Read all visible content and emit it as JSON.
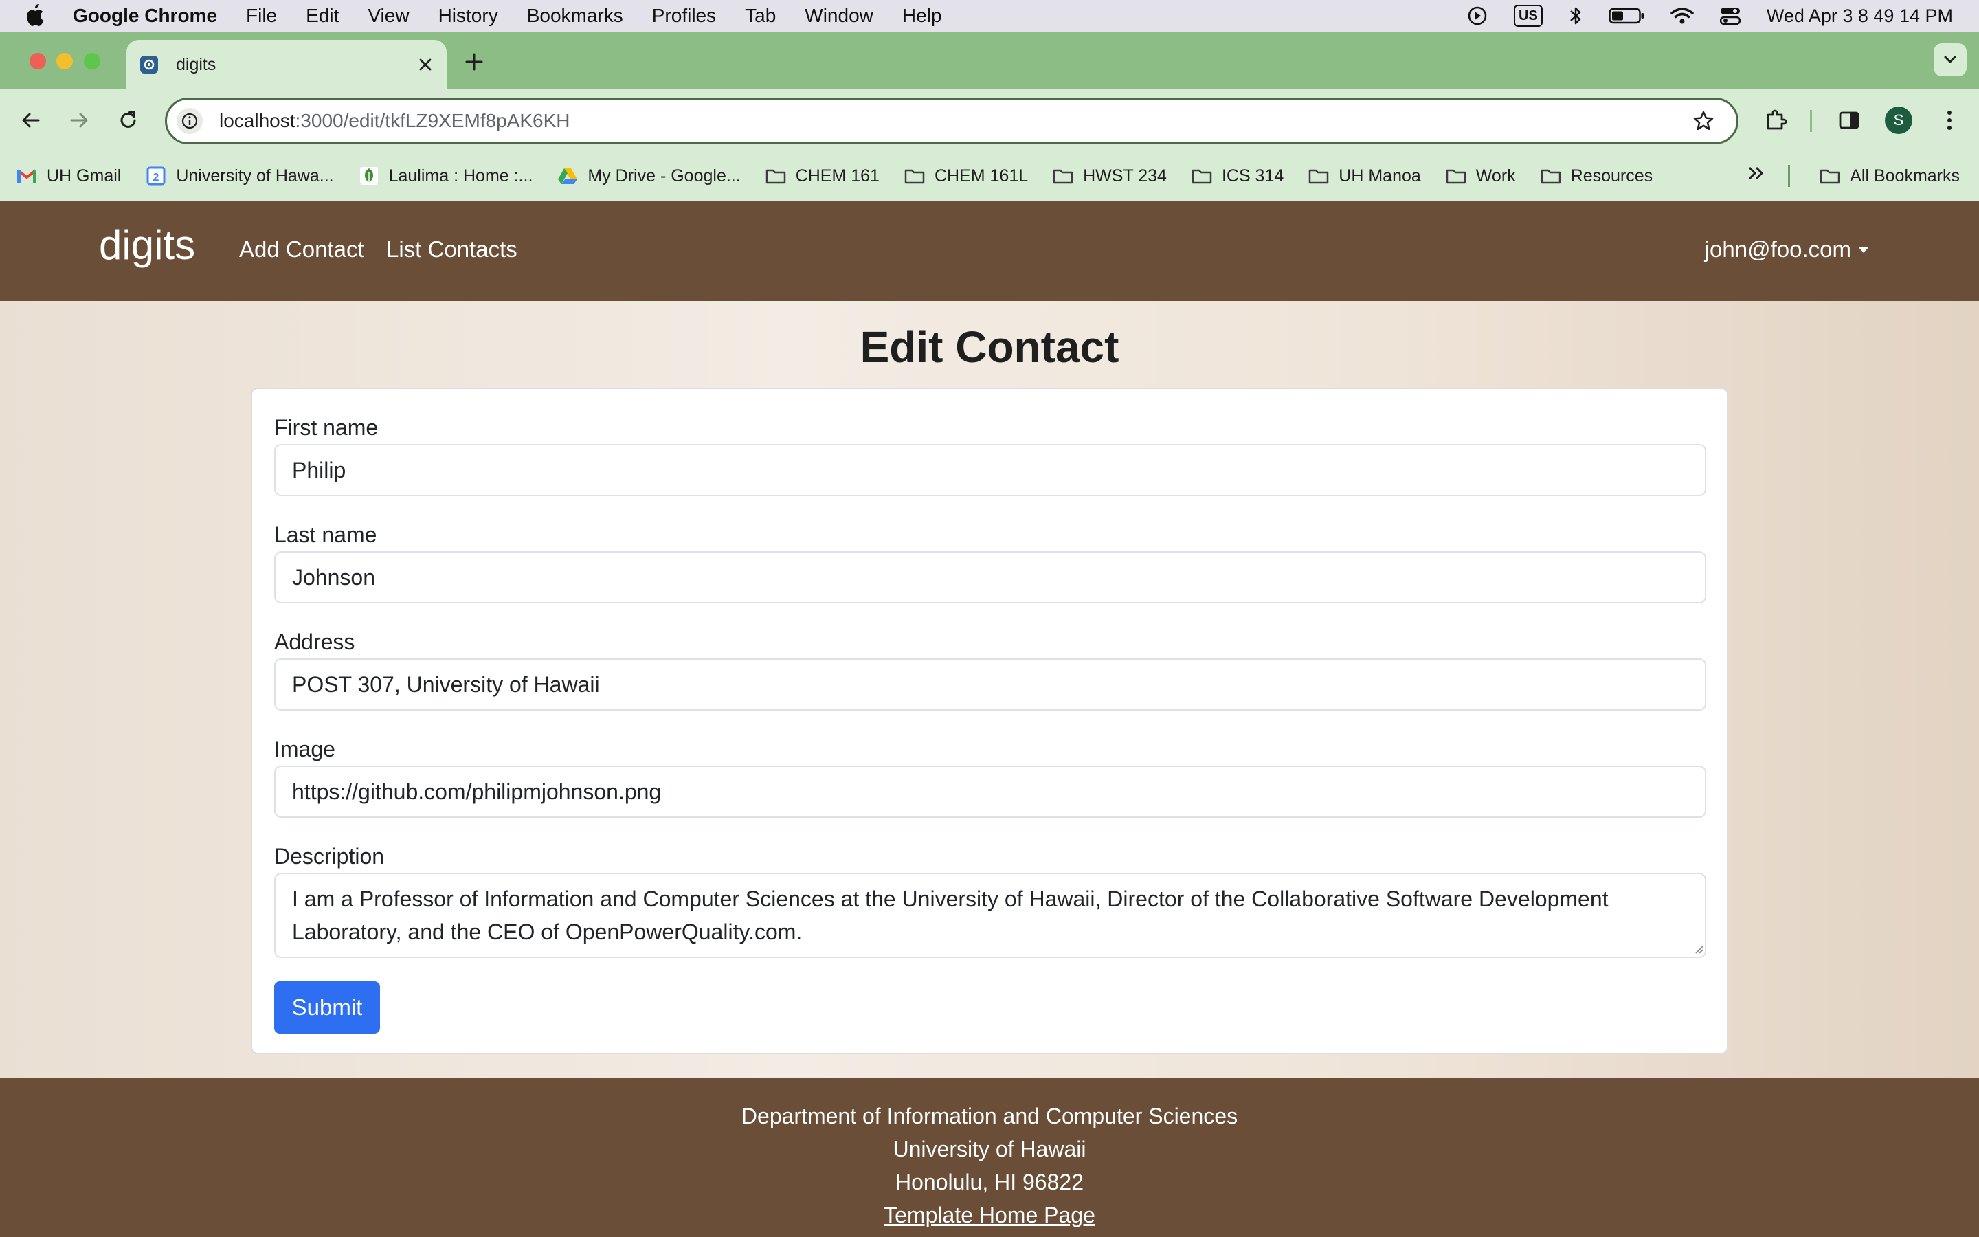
{
  "menubar": {
    "app_name": "Google Chrome",
    "items": [
      "File",
      "Edit",
      "View",
      "History",
      "Bookmarks",
      "Profiles",
      "Tab",
      "Window",
      "Help"
    ],
    "input_source": "US",
    "clock": "Wed Apr 3  8 49 14 PM"
  },
  "browser": {
    "tab_title": "digits",
    "url_host": "localhost",
    "url_path": ":3000/edit/tkfLZ9XEMf8pAK6KH",
    "profile_initial": "S",
    "bookmarks": [
      "UH Gmail",
      "University of Hawa...",
      "Laulima : Home :...",
      "My Drive - Google...",
      "CHEM 161",
      "CHEM 161L",
      "HWST 234",
      "ICS 314",
      "UH Manoa",
      "Work",
      "Resources"
    ],
    "all_bookmarks": "All Bookmarks"
  },
  "navbar": {
    "brand": "digits",
    "links": [
      "Add Contact",
      "List Contacts"
    ],
    "user": "john@foo.com"
  },
  "form": {
    "title": "Edit Contact",
    "fields": [
      {
        "label": "First name",
        "value": "Philip"
      },
      {
        "label": "Last name",
        "value": "Johnson"
      },
      {
        "label": "Address",
        "value": "POST 307, University of Hawaii"
      },
      {
        "label": "Image",
        "value": "https://github.com/philipmjohnson.png"
      },
      {
        "label": "Description",
        "value": "I am a Professor of Information and Computer Sciences at the University of Hawaii, Director of the Collaborative Software Development Laboratory, and the CEO of OpenPowerQuality.com."
      }
    ],
    "submit_label": "Submit"
  },
  "footer": {
    "lines": [
      "Department of Information and Computer Sciences",
      "University of Hawaii",
      "Honolulu, HI 96822"
    ],
    "link": "Template Home Page"
  },
  "colors": {
    "navbar": "#6a4e37",
    "tabstrip": "#8cbd84",
    "toolbar": "#d8ebd4",
    "submit": "#2d6ff0"
  }
}
